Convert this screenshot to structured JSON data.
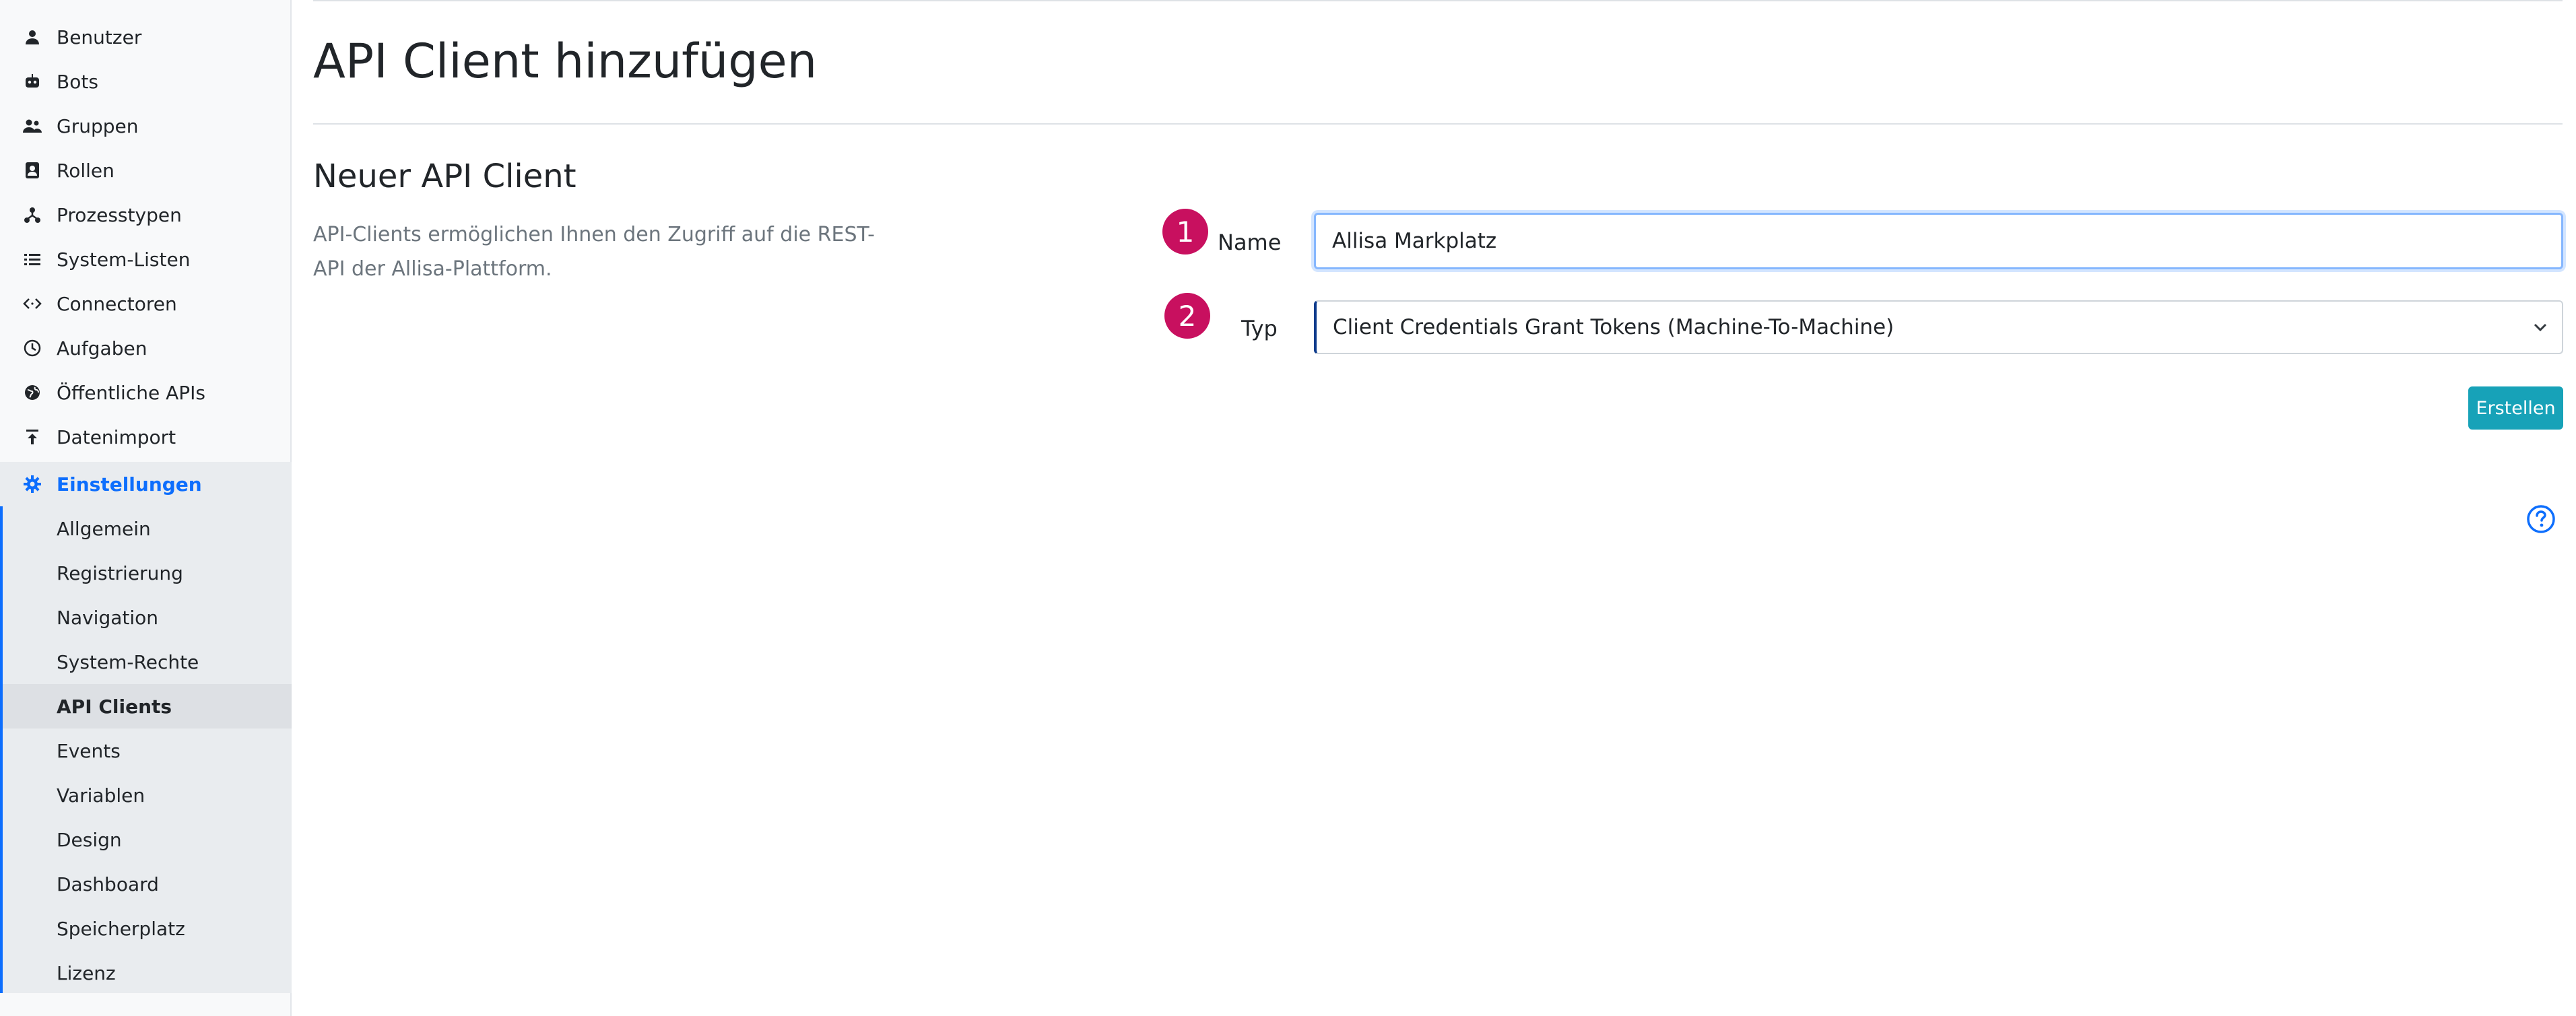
{
  "sidebar": {
    "items": [
      {
        "label": "Benutzer",
        "icon": "user-icon",
        "glyph": "👤"
      },
      {
        "label": "Bots",
        "icon": "bot-icon",
        "glyph": "🤖"
      },
      {
        "label": "Gruppen",
        "icon": "users-icon",
        "glyph": "👥"
      },
      {
        "label": "Rollen",
        "icon": "id-badge-icon",
        "glyph": "🪪"
      },
      {
        "label": "Prozesstypen",
        "icon": "process-icon",
        "glyph": "⑂"
      },
      {
        "label": "System-Listen",
        "icon": "list-icon",
        "glyph": "☰"
      },
      {
        "label": "Connectoren",
        "icon": "code-icon",
        "glyph": "‹›"
      },
      {
        "label": "Aufgaben",
        "icon": "clock-icon",
        "glyph": "◷"
      },
      {
        "label": "Öffentliche APIs",
        "icon": "globe-icon",
        "glyph": "🌐"
      },
      {
        "label": "Datenimport",
        "icon": "upload-icon",
        "glyph": "⤒"
      }
    ],
    "settings": {
      "label": "Einstellungen",
      "icon": "gear-icon",
      "glyph": "⚙"
    },
    "sub_items": [
      {
        "label": "Allgemein"
      },
      {
        "label": "Registrierung"
      },
      {
        "label": "Navigation"
      },
      {
        "label": "System-Rechte"
      },
      {
        "label": "API Clients"
      },
      {
        "label": "Events"
      },
      {
        "label": "Variablen"
      },
      {
        "label": "Design"
      },
      {
        "label": "Dashboard"
      },
      {
        "label": "Speicherplatz"
      },
      {
        "label": "Lizenz"
      }
    ],
    "current_sub_item": "API Clients"
  },
  "main": {
    "page_title": "API Client hinzufügen",
    "section_title": "Neuer API Client",
    "section_description": "API-Clients ermöglichen Ihnen den Zugriff auf die REST-API der Allisa-Plattform.",
    "form": {
      "name_step": "1",
      "name_label": "Name",
      "name_value": "Allisa Markplatz",
      "type_step": "2",
      "type_label": "Typ",
      "type_value": "Client Credentials Grant Tokens (Machine-To-Machine)",
      "submit_label": "Erstellen"
    }
  },
  "colors": {
    "accent": "#0d6efd",
    "step_badge": "#c8105f",
    "button": "#17a2b8"
  }
}
